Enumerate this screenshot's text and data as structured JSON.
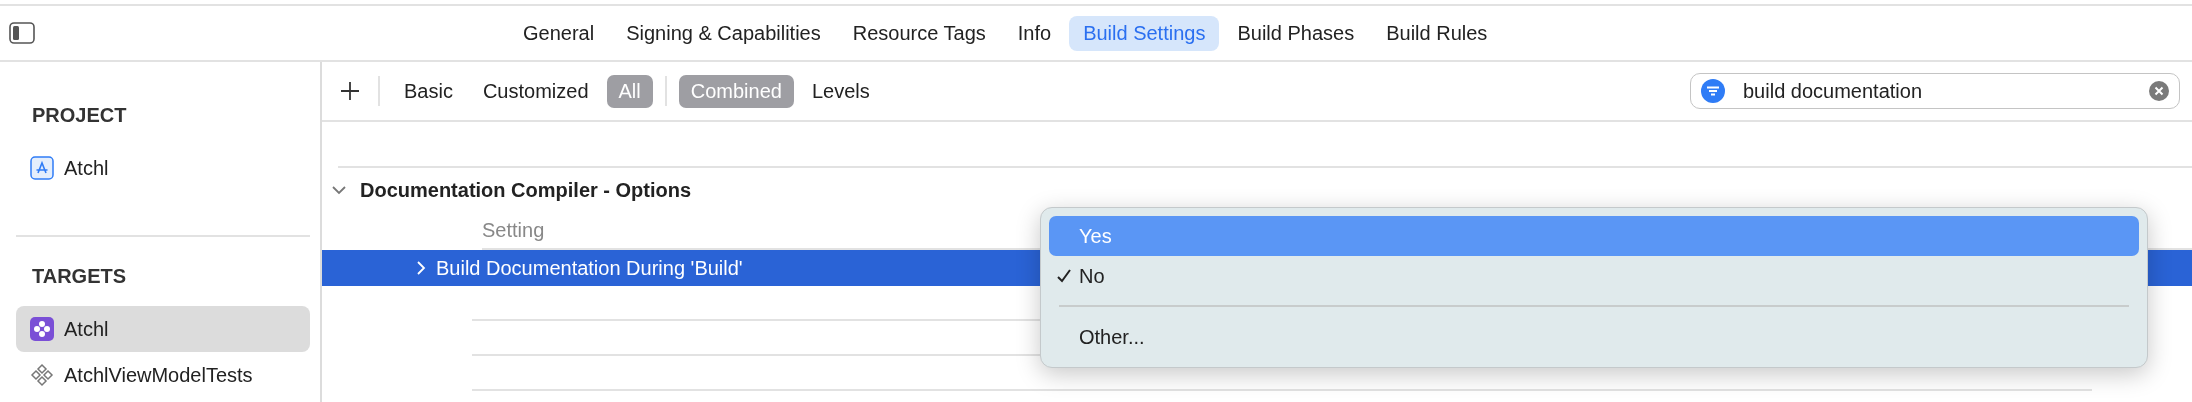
{
  "tabs": [
    {
      "label": "General",
      "selected": false
    },
    {
      "label": "Signing & Capabilities",
      "selected": false
    },
    {
      "label": "Resource Tags",
      "selected": false
    },
    {
      "label": "Info",
      "selected": false
    },
    {
      "label": "Build Settings",
      "selected": true
    },
    {
      "label": "Build Phases",
      "selected": false
    },
    {
      "label": "Build Rules",
      "selected": false
    }
  ],
  "sidebar": {
    "sections": [
      {
        "title": "PROJECT",
        "items": [
          {
            "label": "Atchl",
            "kind": "project",
            "selected": false
          }
        ]
      },
      {
        "title": "TARGETS",
        "items": [
          {
            "label": "Atchl",
            "kind": "app",
            "selected": true
          },
          {
            "label": "AtchlViewModelTests",
            "kind": "test",
            "selected": false
          }
        ]
      }
    ]
  },
  "toolbar": {
    "filters": [
      {
        "label": "Basic",
        "selected": false
      },
      {
        "label": "Customized",
        "selected": false
      },
      {
        "label": "All",
        "selected": true
      }
    ],
    "views": [
      {
        "label": "Combined",
        "selected": true
      },
      {
        "label": "Levels",
        "selected": false
      }
    ]
  },
  "search": {
    "value": "build documentation"
  },
  "settings_section": {
    "title": "Documentation Compiler - Options",
    "expanded": true,
    "column_header": "Setting",
    "rows": [
      {
        "name": "Build Documentation During 'Build'",
        "selected": true,
        "expanded": false
      }
    ]
  },
  "popup_menu": {
    "items": [
      {
        "kind": "option",
        "label": "Yes",
        "highlighted": true,
        "checked": false
      },
      {
        "kind": "option",
        "label": "No",
        "highlighted": false,
        "checked": true
      },
      {
        "kind": "separator"
      },
      {
        "kind": "option",
        "label": "Other...",
        "highlighted": false,
        "checked": false
      }
    ]
  }
}
